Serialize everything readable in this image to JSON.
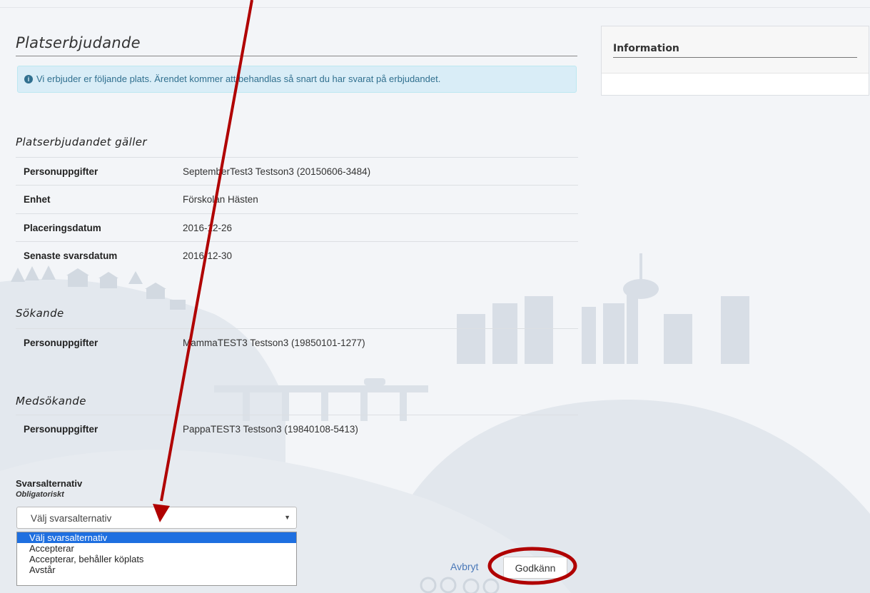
{
  "page": {
    "title": "Platserbjudande",
    "alert": "Vi erbjuder er följande plats. Ärendet kommer att behandlas så snart du har svarat på erbjudandet."
  },
  "offer": {
    "heading": "Platserbjudandet gäller",
    "rows": [
      {
        "label": "Personuppgifter",
        "value": "SeptemberTest3 Testson3 (20150606-3484)"
      },
      {
        "label": "Enhet",
        "value": "Förskolan Hästen"
      },
      {
        "label": "Placeringsdatum",
        "value": "2016-12-26"
      },
      {
        "label": "Senaste svarsdatum",
        "value": "2016-12-30"
      }
    ]
  },
  "applicant": {
    "heading": "Sökande",
    "rows": [
      {
        "label": "Personuppgifter",
        "value": "MammaTEST3 Testson3 (19850101-1277)"
      }
    ]
  },
  "coapplicant": {
    "heading": "Medsökande",
    "rows": [
      {
        "label": "Personuppgifter",
        "value": "PappaTEST3 Testson3 (19840108-5413)"
      }
    ]
  },
  "answer": {
    "label": "Svarsalternativ",
    "sublabel": "Obligatoriskt",
    "selected": "Välj svarsalternativ",
    "options": [
      "Välj svarsalternativ",
      "Accepterar",
      "Accepterar, behåller köplats",
      "Avstår"
    ]
  },
  "actions": {
    "cancel": "Avbryt",
    "submit": "Godkänn"
  },
  "sidebar": {
    "title": "Information"
  },
  "colors": {
    "alert_bg": "#d9edf7",
    "alert_text": "#31708f",
    "annotation": "#b00000",
    "link": "#4a78b8",
    "selected_option": "#1e6fe0"
  }
}
